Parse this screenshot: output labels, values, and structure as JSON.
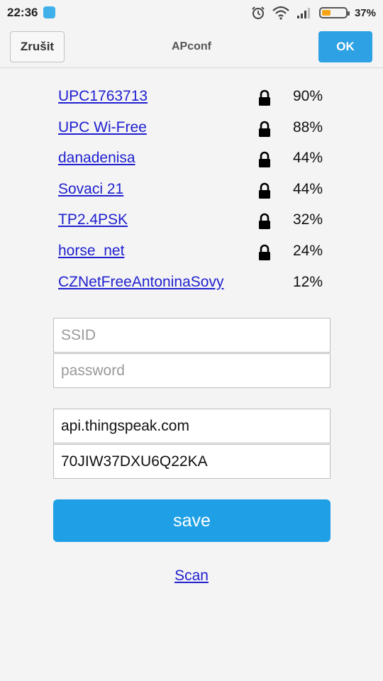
{
  "status_bar": {
    "time": "22:36",
    "battery_pct": "37%",
    "battery_level": 0.37,
    "battery_color": "#f5a316",
    "icons": [
      "app-icon",
      "alarm-icon",
      "wifi-icon",
      "signal-icon",
      "battery-icon"
    ]
  },
  "header": {
    "cancel_label": "Zrušit",
    "title": "APconf",
    "ok_label": "OK"
  },
  "networks": [
    {
      "ssid": "UPC1763713",
      "locked": true,
      "signal": "90%"
    },
    {
      "ssid": "UPC Wi-Free",
      "locked": true,
      "signal": "88%"
    },
    {
      "ssid": "danadenisa",
      "locked": true,
      "signal": "44%"
    },
    {
      "ssid": "Sovaci 21",
      "locked": true,
      "signal": "44%"
    },
    {
      "ssid": "TP2.4PSK",
      "locked": true,
      "signal": "32%"
    },
    {
      "ssid": "horse_net",
      "locked": true,
      "signal": "24%"
    },
    {
      "ssid": "CZNetFreeAntoninaSovy",
      "locked": false,
      "signal": "12%"
    }
  ],
  "form": {
    "ssid_placeholder": "SSID",
    "ssid_value": "",
    "password_placeholder": "password",
    "password_value": "",
    "host_value": "api.thingspeak.com",
    "key_value": "70JIW37DXU6Q22KA",
    "save_label": "save"
  },
  "scan_label": "Scan",
  "colors": {
    "accent": "#1fa0e6",
    "link": "#1f1fd0"
  }
}
